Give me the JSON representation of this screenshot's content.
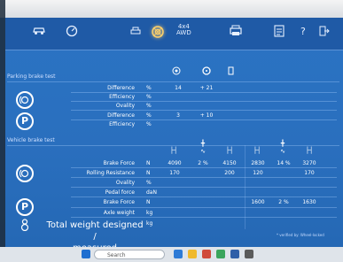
{
  "toolbar": {
    "items": [
      {
        "icon": "car-icon"
      },
      {
        "icon": "gauge-icon"
      },
      {
        "icon": "settings-icon",
        "label": ""
      },
      {
        "icon": "brake-icon",
        "label": ""
      },
      {
        "icon": "4x4-icon",
        "label": "4x4\nAWD"
      },
      {
        "icon": "printer-icon"
      },
      {
        "icon": "report-icon"
      },
      {
        "icon": "help-icon"
      },
      {
        "icon": "exit-icon"
      }
    ]
  },
  "parking": {
    "section_title": "Parking brake test",
    "rows": [
      {
        "label": "Difference",
        "unit": "%",
        "v1": "14",
        "v2": "+ 21"
      },
      {
        "label": "Efficiency",
        "unit": "%",
        "v1": "",
        "v2": ""
      },
      {
        "label": "Ovality",
        "unit": "%",
        "v1": "",
        "v2": ""
      },
      {
        "label": "Difference",
        "unit": "%",
        "v1": "3",
        "v2": "+ 10"
      },
      {
        "label": "Efficiency",
        "unit": "%",
        "v1": "",
        "v2": ""
      }
    ]
  },
  "service": {
    "section_title": "Vehicle brake test",
    "rows": [
      {
        "label": "Brake Force",
        "unit": "N",
        "c": [
          "4090",
          "2 %",
          "4150",
          "2830",
          "14 %",
          "3270"
        ]
      },
      {
        "label": "Rolling Resistance",
        "unit": "N",
        "c": [
          "170",
          "",
          "200",
          "120",
          "",
          "170"
        ]
      },
      {
        "label": "Ovality",
        "unit": "%",
        "c": [
          "",
          "",
          "",
          "",
          "",
          ""
        ]
      },
      {
        "label": "Pedal force",
        "unit": "daN",
        "c": [
          "",
          "",
          "",
          "",
          "",
          ""
        ]
      },
      {
        "label": "Brake Force",
        "unit": "N",
        "c": [
          "",
          "",
          "",
          "1600",
          "2 %",
          "1630"
        ]
      },
      {
        "label": "Axle weight",
        "unit": "kg",
        "c": [
          "",
          "",
          "",
          "",
          "",
          ""
        ]
      }
    ]
  },
  "total_weight": {
    "label_line1": "Total weight designed /",
    "label_line2": "measured",
    "unit": "kg"
  },
  "note": "* verified by: Wheel-locked",
  "taskbar": {
    "search_placeholder": "Search"
  },
  "colors": {
    "screen_blue": "#2a6fbe",
    "toolbar_blue": "#1f5aa6",
    "text": "#ffffff"
  }
}
